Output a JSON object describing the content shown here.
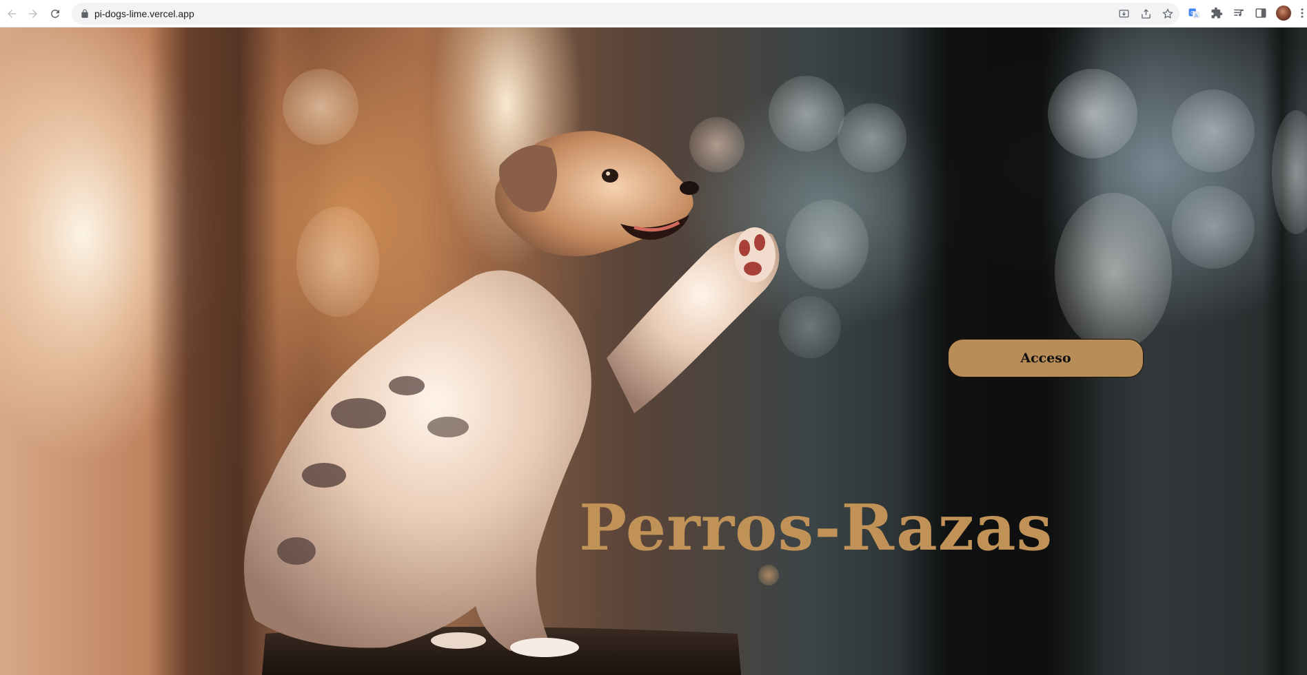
{
  "browser": {
    "url": "pi-dogs-lime.vercel.app",
    "icons": {
      "back": "arrow-left-icon",
      "forward": "arrow-right-icon",
      "reload": "reload-icon",
      "lock": "lock-icon",
      "install": "install-app-icon",
      "share": "share-icon",
      "bookmark": "star-icon",
      "translate": "translate-icon",
      "extensions": "puzzle-icon",
      "media": "media-controls-icon",
      "side_panel": "side-panel-icon",
      "profile": "avatar",
      "menu": "kebab-menu-icon"
    }
  },
  "landing": {
    "login_button": "Acceso",
    "title": "Perros-Razas"
  },
  "colors": {
    "accent": "#b98d58",
    "title": "#c19258",
    "button_border": "#1b1309"
  }
}
